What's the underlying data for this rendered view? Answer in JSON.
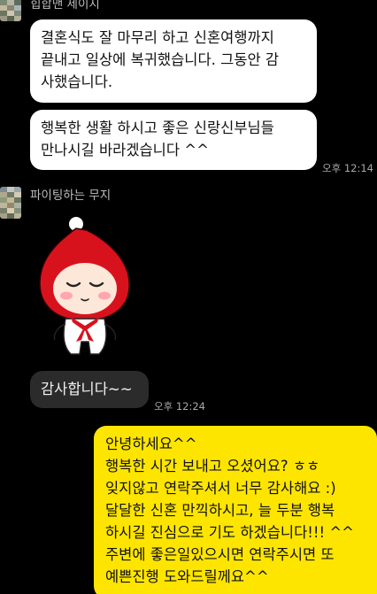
{
  "messages": [
    {
      "sender": "힙합맨 제이지",
      "bubbles": [
        [
          "결혼식도 잘 마무리 하고 신혼여행까지",
          "끝내고 일상에 복귀했습니다. 그동안 감",
          "사했습니다."
        ],
        [
          "행복한 생활 하시고 좋은 신랑신부님들",
          "만나시길 바라겠습니다 ^^"
        ]
      ],
      "time": "오후 12:14"
    },
    {
      "sender": "파이팅하는 무지",
      "sticker": "red-hood-character-sticker",
      "bubbles": [
        [
          "감사합니다~~"
        ]
      ],
      "time": "오후 12:24"
    },
    {
      "sender": "me",
      "bubbles": [
        [
          "안녕하세요^^",
          "행복한 시간 보내고 오셨어요? ㅎㅎ",
          "잊지않고 연락주셔서 너무 감사해요 :)",
          "달달한 신혼 만끽하시고, 늘 두분 행복",
          "하시길 진심으로 기도 하겠습니다!!! ^^",
          "주변에 좋은일있으시면 연락주시면 또",
          "예쁜진행 도와드릴께요^^"
        ]
      ]
    }
  ],
  "colors": {
    "background": "#000000",
    "incoming_bubble": "#ffffff",
    "sticker_reply_bubble": "#2b2b2b",
    "outgoing_bubble": "#fee500",
    "timestamp": "#a8a8a8",
    "sender_name": "#bdbdbd"
  }
}
